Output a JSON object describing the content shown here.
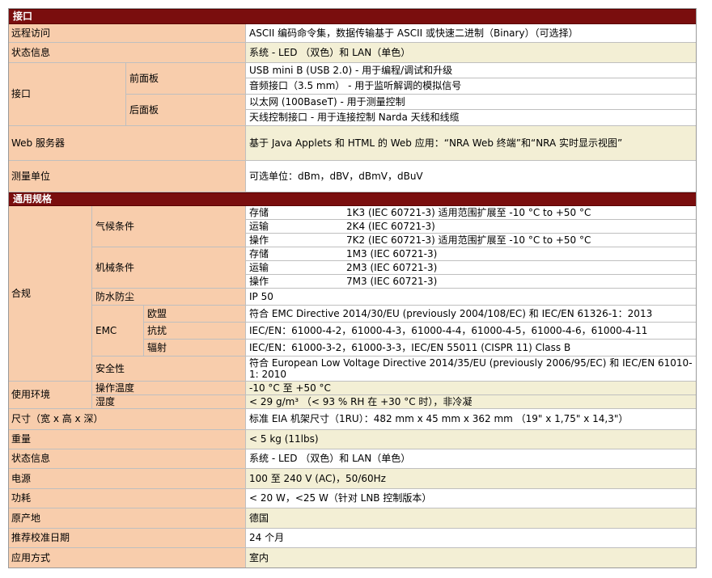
{
  "sections": {
    "interface_title": "接口",
    "general_title": "通用规格"
  },
  "rows": {
    "remote_access": {
      "label": "远程访问",
      "value": "ASCII 编码命令集，数据传输基于 ASCII 或快速二进制（Binary）（可选择）"
    },
    "status_info": {
      "label": "状态信息",
      "value": "系统 - LED （双色）和 LAN（单色）"
    },
    "interface": {
      "label": "接口",
      "front_label": "前面板",
      "front_values": [
        "USB mini B (USB 2.0) - 用于编程/调试和升级",
        "音频接口（3.5 mm）  - 用于监听解调的模拟信号"
      ],
      "rear_label": "后面板",
      "rear_values": [
        "以太网 (100BaseT)     - 用于测量控制",
        "天线控制接口       - 用于连接控制 Narda 天线和线缆"
      ]
    },
    "web_server": {
      "label": "Web 服务器",
      "value": "基于 Java Applets 和 HTML 的 Web 应用：“NRA Web 终端”和“NRA 实时显示视图”"
    },
    "units": {
      "label": "测量单位",
      "value": "可选单位：dBm，dBV，dBmV，dBuV"
    },
    "compliance": {
      "label": "合规",
      "climate_label": "气候条件",
      "climate": [
        {
          "k": "存储",
          "v": "1K3 (IEC 60721-3) 适用范围扩展至 -10 °C to +50 °C"
        },
        {
          "k": "运输",
          "v": "2K4 (IEC 60721-3)"
        },
        {
          "k": "操作",
          "v": "7K2 (IEC 60721-3) 适用范围扩展至 -10 °C to +50 °C"
        }
      ],
      "mech_label": "机械条件",
      "mech": [
        {
          "k": "存储",
          "v": "1M3 (IEC 60721-3)"
        },
        {
          "k": "运输",
          "v": "2M3 (IEC 60721-3)"
        },
        {
          "k": "操作",
          "v": "7M3 (IEC 60721-3)"
        }
      ],
      "ip_label": "防水防尘",
      "ip_value": "IP 50",
      "emc_label": "EMC",
      "emc": [
        {
          "k": "欧盟",
          "v": "符合 EMC Directive 2014/30/EU (previously 2004/108/EC) 和 IEC/EN 61326-1：2013"
        },
        {
          "k": "抗扰",
          "v": "IEC/EN：61000-4-2，61000-4-3，61000-4-4，61000-4-5，61000-4-6，61000-4-11"
        },
        {
          "k": "辐射",
          "v": "IEC/EN：61000-3-2，61000-3-3，IEC/EN 55011 (CISPR 11) Class B"
        }
      ],
      "safety_label": "安全性",
      "safety_value": "符合 European Low Voltage Directive 2014/35/EU (previously 2006/95/EC) 和 IEC/EN 61010-1: 2010"
    },
    "environment": {
      "label": "使用环境",
      "temp_label": "操作温度",
      "temp_value": "-10 °C 至 +50 °C",
      "hum_label": "湿度",
      "hum_value": "< 29 g/m³ （< 93 % RH 在 +30 °C 时），非冷凝"
    },
    "size": {
      "label": "尺寸（宽 x 高 x 深）",
      "value": "标准 EIA 机架尺寸（1RU）：482 mm x 45 mm x 362 mm （19\" x 1,75\" x 14,3\"）"
    },
    "weight": {
      "label": "重量",
      "value": "< 5 kg (11lbs)"
    },
    "status_info2": {
      "label": "状态信息",
      "value": "系统 - LED （双色）和 LAN（单色）"
    },
    "power": {
      "label": "电源",
      "value": "100 至 240 V (AC)，50/60Hz"
    },
    "consumption": {
      "label": "功耗",
      "value": "< 20 W，<25 W（针对 LNB 控制版本）"
    },
    "origin": {
      "label": "原产地",
      "value": "德国"
    },
    "calibration": {
      "label": "推荐校准日期",
      "value": "24 个月"
    },
    "application": {
      "label": "应用方式",
      "value": "室内"
    }
  }
}
